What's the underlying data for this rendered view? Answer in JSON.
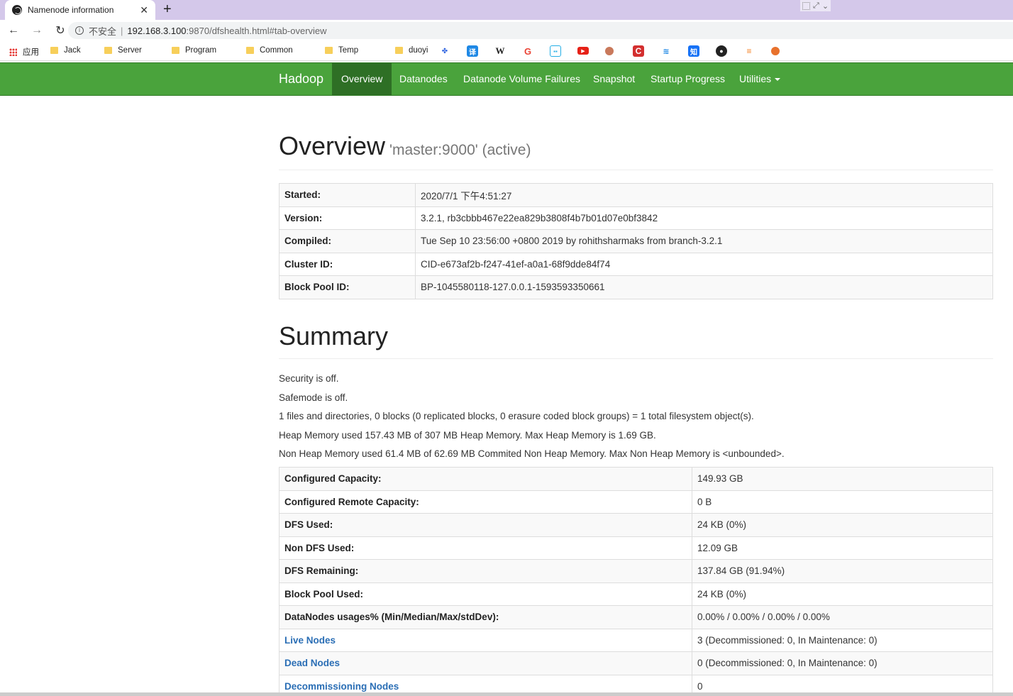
{
  "browser": {
    "tab_title": "Namenode information",
    "new_tab": "+",
    "close": "✕",
    "insecure": "不安全",
    "url_host": "192.168.3.100",
    "url_path": ":9870/dfshealth.html#tab-overview"
  },
  "bookmarks": {
    "apps": "应用",
    "folders": [
      "Jack",
      "Server",
      "Program",
      "Common",
      "Temp",
      "duoyi"
    ]
  },
  "navbar": {
    "brand": "Hadoop",
    "items": [
      "Overview",
      "Datanodes",
      "Datanode Volume Failures",
      "Snapshot",
      "Startup Progress",
      "Utilities"
    ]
  },
  "overview": {
    "title": "Overview",
    "subtitle": "'master:9000' (active)",
    "rows": [
      {
        "k": "Started:",
        "v": "2020/7/1 下午4:51:27"
      },
      {
        "k": "Version:",
        "v": "3.2.1, rb3cbbb467e22ea829b3808f4b7b01d07e0bf3842"
      },
      {
        "k": "Compiled:",
        "v": "Tue Sep 10 23:56:00 +0800 2019 by rohithsharmaks from branch-3.2.1"
      },
      {
        "k": "Cluster ID:",
        "v": "CID-e673af2b-f247-41ef-a0a1-68f9dde84f74"
      },
      {
        "k": "Block Pool ID:",
        "v": "BP-1045580118-127.0.0.1-1593593350661"
      }
    ]
  },
  "summary": {
    "title": "Summary",
    "lines": [
      "Security is off.",
      "Safemode is off.",
      "1 files and directories, 0 blocks (0 replicated blocks, 0 erasure coded block groups) = 1 total filesystem object(s).",
      "Heap Memory used 157.43 MB of 307 MB Heap Memory. Max Heap Memory is 1.69 GB.",
      "Non Heap Memory used 61.4 MB of 62.69 MB Commited Non Heap Memory. Max Non Heap Memory is <unbounded>."
    ],
    "rows": [
      {
        "k": "Configured Capacity:",
        "v": "149.93 GB"
      },
      {
        "k": "Configured Remote Capacity:",
        "v": "0 B"
      },
      {
        "k": "DFS Used:",
        "v": "24 KB (0%)"
      },
      {
        "k": "Non DFS Used:",
        "v": "12.09 GB"
      },
      {
        "k": "DFS Remaining:",
        "v": "137.84 GB (91.94%)"
      },
      {
        "k": "Block Pool Used:",
        "v": "24 KB (0%)"
      },
      {
        "k": "DataNodes usages% (Min/Median/Max/stdDev):",
        "v": "0.00% / 0.00% / 0.00% / 0.00%"
      },
      {
        "k": "Live Nodes",
        "v": "3 (Decommissioned: 0, In Maintenance: 0)"
      },
      {
        "k": "Dead Nodes",
        "v": "0 (Decommissioned: 0, In Maintenance: 0)"
      },
      {
        "k": "Decommissioning Nodes",
        "v": "0"
      }
    ]
  },
  "colors": {
    "navbar": "#4aa33c",
    "navbar_active": "#2e6f25",
    "link": "#2a6eb5",
    "tabstrip": "#d4c8ea"
  }
}
